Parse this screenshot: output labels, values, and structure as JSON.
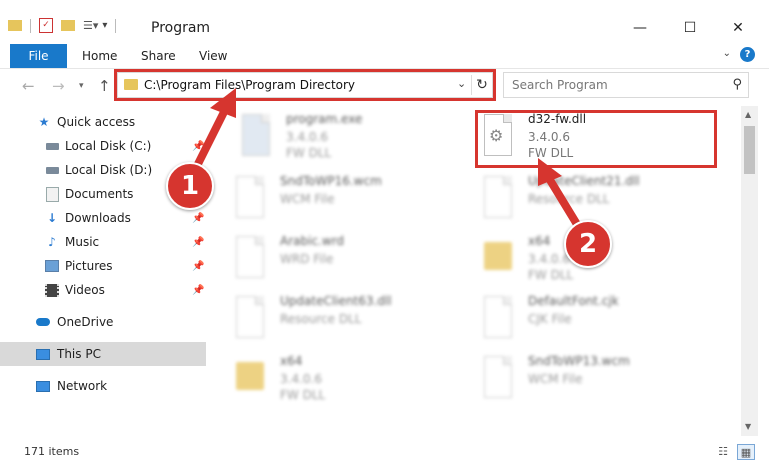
{
  "window": {
    "title": "Program",
    "minimize_glyph": "—",
    "maximize_glyph": "☐",
    "close_glyph": "✕"
  },
  "ribbon": {
    "file": "File",
    "home": "Home",
    "share": "Share",
    "view": "View",
    "help": "?"
  },
  "address": {
    "path": "C:\\Program Files\\Program Directory"
  },
  "search": {
    "placeholder": "Search Program"
  },
  "sidebar": {
    "items": [
      {
        "label": "Quick access",
        "icon": "star-icon"
      },
      {
        "label": "Local Disk (C:)",
        "icon": "drive-icon"
      },
      {
        "label": "Local Disk (D:)",
        "icon": "drive-icon"
      },
      {
        "label": "Documents",
        "icon": "documents-icon"
      },
      {
        "label": "Downloads",
        "icon": "download-arrow-icon"
      },
      {
        "label": "Music",
        "icon": "music-note-icon"
      },
      {
        "label": "Pictures",
        "icon": "pictures-icon"
      },
      {
        "label": "Videos",
        "icon": "film-icon"
      },
      {
        "label": "OneDrive",
        "icon": "cloud-icon"
      },
      {
        "label": "This PC",
        "icon": "monitor-icon"
      },
      {
        "label": "Network",
        "icon": "network-icon"
      }
    ]
  },
  "files": [
    {
      "name": "program.exe",
      "line2": "3.4.0.6",
      "line3": "FW DLL"
    },
    {
      "name": "d32-fw.dll",
      "line2": "3.4.0.6",
      "line3": "FW DLL"
    },
    {
      "name": "SndToWP16.wcm",
      "line2": "WCM File",
      "line3": ""
    },
    {
      "name": "UpdateClient21.dll",
      "line2": "Resource DLL",
      "line3": ""
    },
    {
      "name": "Arabic.wrd",
      "line2": "WRD File",
      "line3": ""
    },
    {
      "name": "x64",
      "line2": "3.4.0.6",
      "line3": "FW DLL"
    },
    {
      "name": "UpdateClient63.dll",
      "line2": "Resource DLL",
      "line3": ""
    },
    {
      "name": "DefaultFont.cjk",
      "line2": "CJK File",
      "line3": ""
    },
    {
      "name": "x64",
      "line2": "3.4.0.6",
      "line3": "FW DLL"
    },
    {
      "name": "SndToWP13.wcm",
      "line2": "WCM File",
      "line3": ""
    }
  ],
  "status": {
    "items_count": "171 items"
  },
  "annotations": {
    "step1": "1",
    "step2": "2",
    "color": "#d6352f"
  }
}
